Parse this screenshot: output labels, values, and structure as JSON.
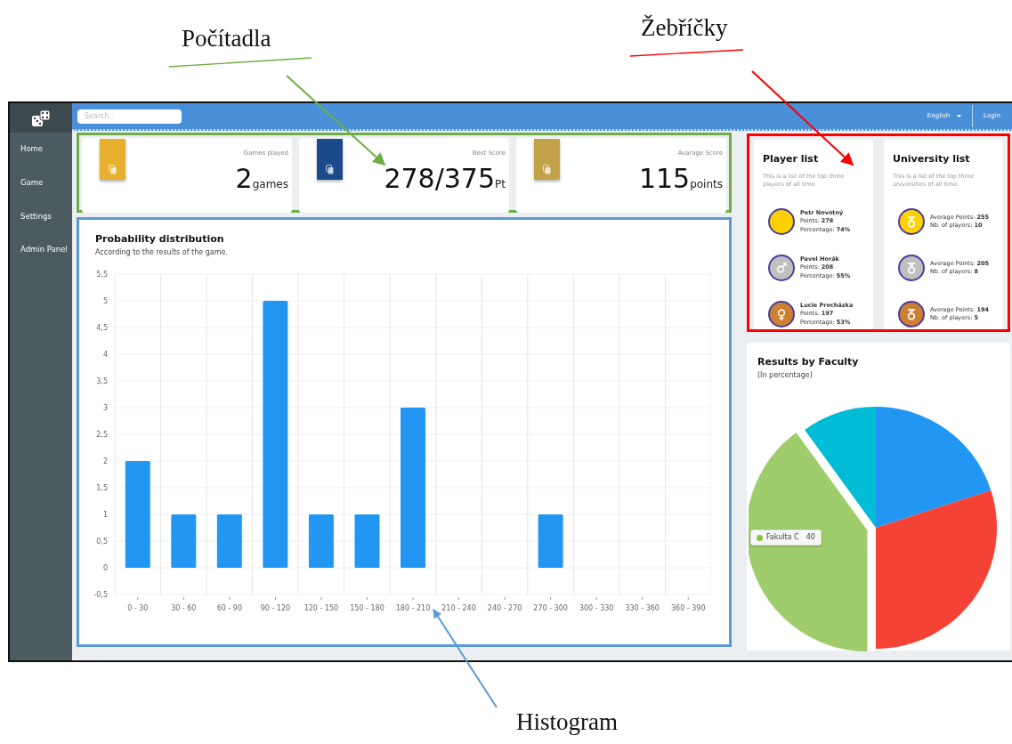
{
  "callouts": [
    {
      "label": "Počítadla",
      "color": "#70ad47"
    },
    {
      "label": "Žebříčky",
      "color": "#ff0000"
    },
    {
      "label": "Histogram",
      "color": "#5b9bd5"
    }
  ],
  "sidebar": {
    "items": [
      {
        "label": "Home"
      },
      {
        "label": "Game"
      },
      {
        "label": "Settings"
      },
      {
        "label": "Admin Panel"
      }
    ]
  },
  "topbar": {
    "search": {
      "placeholder": "Search.."
    },
    "language": "English",
    "login": "Login"
  },
  "counters": [
    {
      "label": "Games played",
      "value": "2",
      "unit": "games",
      "color": "#e8b030"
    },
    {
      "label": "Best Score",
      "value": "278/375",
      "unit": "Pt",
      "color": "#1a4a8a"
    },
    {
      "label": "Avarage Score",
      "value": "115",
      "unit": "points",
      "color": "#c4a24a"
    }
  ],
  "histogram": {
    "title": "Probability distribution",
    "subtitle": "According to the results of the game.",
    "chart_data": {
      "type": "bar",
      "categories": [
        "0 - 30",
        "30 - 60",
        "60 - 90",
        "90 - 120",
        "120 - 150",
        "150 - 180",
        "180 - 210",
        "210 - 240",
        "240 - 270",
        "270 - 300",
        "300 - 330",
        "330 - 360",
        "360 - 390"
      ],
      "grid": true,
      "series": [
        {
          "color": "#2196f3",
          "values": [
            2,
            1,
            1,
            5,
            1,
            1,
            3,
            0,
            0,
            1,
            0,
            0,
            0
          ]
        }
      ],
      "ylim": [
        -0.5,
        5.5
      ],
      "yticks": [
        {
          "value": -0.5,
          "label": "-0,5"
        },
        {
          "value": 0,
          "label": "0"
        },
        {
          "value": 0.5,
          "label": "0,5"
        },
        {
          "value": 1,
          "label": "1"
        },
        {
          "value": 1.5,
          "label": "1,5"
        },
        {
          "value": 2,
          "label": "2"
        },
        {
          "value": 2.5,
          "label": "2,5"
        },
        {
          "value": 3,
          "label": "3"
        },
        {
          "value": 3.5,
          "label": "3,5"
        },
        {
          "value": 4,
          "label": "4"
        },
        {
          "value": 4.5,
          "label": "4,5"
        },
        {
          "value": 5,
          "label": "5"
        },
        {
          "value": 5.5,
          "label": "5,5"
        }
      ]
    }
  },
  "player_list": {
    "title": "Player list",
    "description": "This is a list of the top three players of all time.",
    "items": [
      {
        "name": "Petr Novotný",
        "points": "Points: **278**",
        "percentage": "Percentage: **74%**",
        "color": "#ffd000",
        "kind": "plain"
      },
      {
        "name": "Pavel Horák",
        "points": "Points: **208**",
        "percentage": "Percentage: **55%**",
        "color": "#c0c0c0",
        "kind": "male"
      },
      {
        "name": "Lucie Procházka",
        "points": "Points: **197**",
        "percentage": "Percentage: **53%**",
        "color": "#cd7f32",
        "kind": "female"
      }
    ]
  },
  "university_list": {
    "title": "University list",
    "description": "This is a list of the top three universities of all time.",
    "items": [
      {
        "average": "Average Points: **255**",
        "players": "Nb. of players: **10**",
        "color": "#ffd000"
      },
      {
        "average": "Average Points: **205**",
        "players": "Nb. of players: **8**",
        "color": "#c0c0c0"
      },
      {
        "average": "Average Points: **194**",
        "players": "Nb. of players: **5**",
        "color": "#cd7f32"
      }
    ]
  },
  "faculty_chart": {
    "title": "Results by Faculty",
    "subtitle": "(In percentage)",
    "tooltip": {
      "label": "Fakulta C",
      "value": "40",
      "color": "#8bc34a"
    }
  }
}
